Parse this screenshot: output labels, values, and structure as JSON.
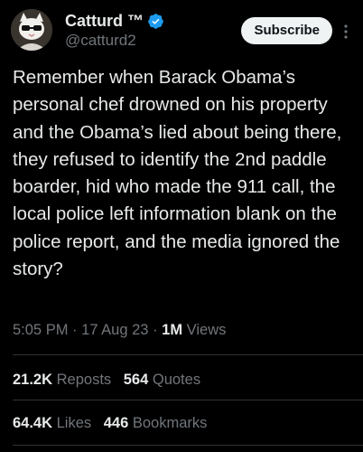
{
  "author": {
    "display_name": "Catturd ™",
    "handle": "@catturd2",
    "verified_color": "#1d9bf0"
  },
  "subscribe_label": "Subscribe",
  "tweet_text": "Remember when Barack Obama’s personal chef drowned on his property and the Obama’s lied about being there, they refused to identify the 2nd paddle boarder, hid who made the 911 call, the local police left information blank on the police report, and the media ignored the story?",
  "meta": {
    "time": "5:05 PM",
    "separator": "·",
    "date": "17 Aug 23",
    "views_count": "1M",
    "views_label": "Views"
  },
  "stats": {
    "reposts_count": "21.2K",
    "reposts_label": "Reposts",
    "quotes_count": "564",
    "quotes_label": "Quotes",
    "likes_count": "64.4K",
    "likes_label": "Likes",
    "bookmarks_count": "446",
    "bookmarks_label": "Bookmarks"
  },
  "icons": {
    "verified": "verified-badge-icon",
    "more": "more-vertical-icon"
  },
  "colors": {
    "background": "#000000",
    "text": "#e7e9ea",
    "secondary": "#71767b",
    "divider": "#2f3336"
  }
}
